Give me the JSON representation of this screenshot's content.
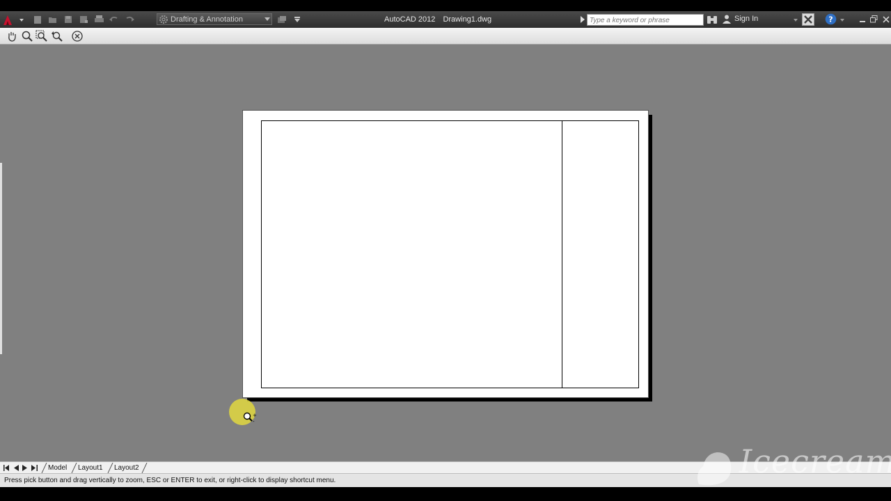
{
  "titlebar": {
    "app_name": "AutoCAD 2012",
    "document": "Drawing1.dwg",
    "workspace": "Drafting & Annotation",
    "search_placeholder": "Type a keyword or phrase",
    "signin_label": "Sign In"
  },
  "quick_access": [
    "new-icon",
    "open-icon",
    "save-icon",
    "save-as-icon",
    "plot-icon",
    "undo-icon",
    "redo-icon"
  ],
  "navigation_tools": [
    "pan-icon",
    "zoom-realtime-icon",
    "zoom-window-icon",
    "zoom-previous-icon",
    "close-icon"
  ],
  "layout_tabs": {
    "tabs": [
      "Model",
      "Layout1",
      "Layout2"
    ],
    "active": "Model"
  },
  "status": {
    "prompt": "Press pick button and drag vertically to zoom, ESC or ENTER to exit, or right-click to display shortcut menu."
  },
  "watermark": {
    "text": "Icecream"
  },
  "colors": {
    "drawing_background": "#808080",
    "titlebar": "#3a3a3a",
    "cursor_highlight": "#e2d840",
    "app_logo": "#c8102e"
  }
}
